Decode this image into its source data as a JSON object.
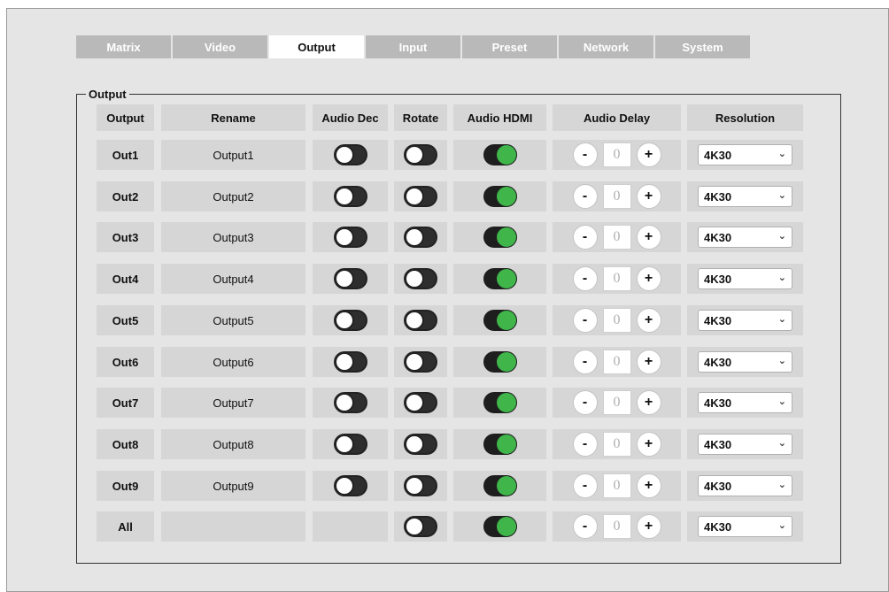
{
  "tabs": [
    "Matrix",
    "Video",
    "Output",
    "Input",
    "Preset",
    "Network",
    "System"
  ],
  "active_tab": "Output",
  "group_title": "Output",
  "headers": {
    "output": "Output",
    "rename": "Rename",
    "audio_dec": "Audio Dec",
    "rotate": "Rotate",
    "audio_hdmi": "Audio HDMI",
    "audio_delay": "Audio Delay",
    "resolution": "Resolution"
  },
  "rows": [
    {
      "label": "Out1",
      "name": "Output1",
      "audio_dec": false,
      "rotate": false,
      "audio_hdmi": true,
      "delay": "0",
      "resolution": "4K30"
    },
    {
      "label": "Out2",
      "name": "Output2",
      "audio_dec": false,
      "rotate": false,
      "audio_hdmi": true,
      "delay": "0",
      "resolution": "4K30"
    },
    {
      "label": "Out3",
      "name": "Output3",
      "audio_dec": false,
      "rotate": false,
      "audio_hdmi": true,
      "delay": "0",
      "resolution": "4K30"
    },
    {
      "label": "Out4",
      "name": "Output4",
      "audio_dec": false,
      "rotate": false,
      "audio_hdmi": true,
      "delay": "0",
      "resolution": "4K30"
    },
    {
      "label": "Out5",
      "name": "Output5",
      "audio_dec": false,
      "rotate": false,
      "audio_hdmi": true,
      "delay": "0",
      "resolution": "4K30"
    },
    {
      "label": "Out6",
      "name": "Output6",
      "audio_dec": false,
      "rotate": false,
      "audio_hdmi": true,
      "delay": "0",
      "resolution": "4K30"
    },
    {
      "label": "Out7",
      "name": "Output7",
      "audio_dec": false,
      "rotate": false,
      "audio_hdmi": true,
      "delay": "0",
      "resolution": "4K30"
    },
    {
      "label": "Out8",
      "name": "Output8",
      "audio_dec": false,
      "rotate": false,
      "audio_hdmi": true,
      "delay": "0",
      "resolution": "4K30"
    },
    {
      "label": "Out9",
      "name": "Output9",
      "audio_dec": false,
      "rotate": false,
      "audio_hdmi": true,
      "delay": "0",
      "resolution": "4K30"
    }
  ],
  "all_row": {
    "label": "All",
    "rotate": false,
    "audio_hdmi": true,
    "delay": "0",
    "resolution": "4K30"
  },
  "delay_minus": "-",
  "delay_plus": "+",
  "colors": {
    "toggle_on": "#3fb54a",
    "tab_inactive": "#b9b9b9",
    "panel_bg": "#e5e5e5",
    "cell_bg": "#d6d6d6"
  }
}
